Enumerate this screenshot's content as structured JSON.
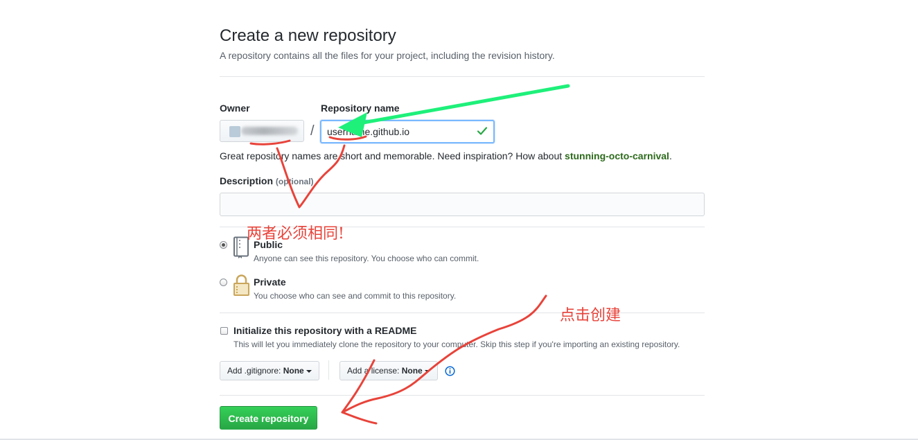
{
  "header": {
    "title": "Create a new repository",
    "subtitle": "A repository contains all the files for your project, including the revision history."
  },
  "owner": {
    "label": "Owner"
  },
  "repo_name": {
    "label": "Repository name",
    "value": "username.github.io",
    "separator": "/"
  },
  "hint": {
    "text": "Great repository names are short and memorable. Need inspiration? How about ",
    "suggestion": "stunning-octo-carnival",
    "suffix": "."
  },
  "description": {
    "label": "Description",
    "optional": "(optional)",
    "value": ""
  },
  "visibility": {
    "public": {
      "title": "Public",
      "note": "Anyone can see this repository. You choose who can commit.",
      "checked": true
    },
    "private": {
      "title": "Private",
      "note": "You choose who can see and commit to this repository.",
      "checked": false
    }
  },
  "readme": {
    "title": "Initialize this repository with a README",
    "note": "This will let you immediately clone the repository to your computer. Skip this step if you're importing an existing repository."
  },
  "gitignore": {
    "prefix": "Add .gitignore: ",
    "value": "None"
  },
  "license": {
    "prefix": "Add a license: ",
    "value": "None"
  },
  "submit": {
    "label": "Create repository"
  },
  "annotations": {
    "same_note": "两者必须相同!",
    "click_note": "点击创建"
  },
  "colors": {
    "accent_green": "#28a745",
    "annotation_red": "#e8433a",
    "annotation_arrow": "#1ef07a",
    "focus_blue": "#79b8ff"
  }
}
